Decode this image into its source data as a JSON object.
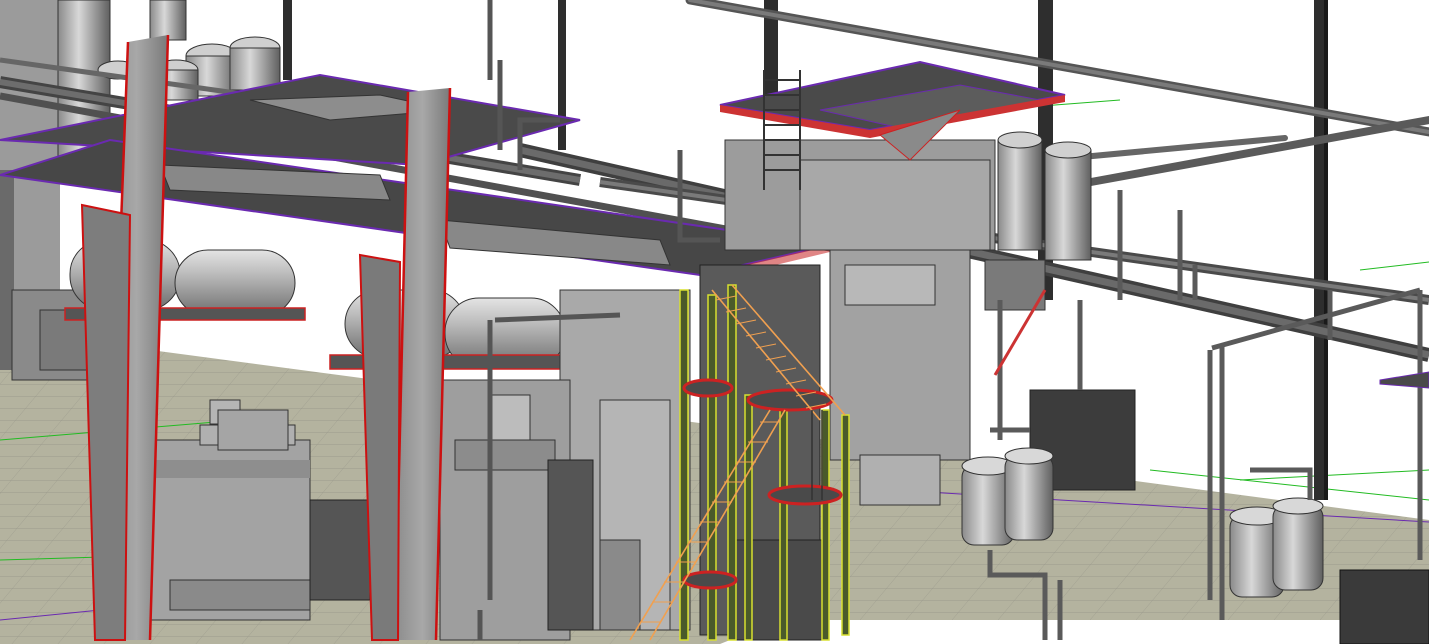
{
  "view": {
    "type": "3d-model-viewport",
    "style": "shaded-with-edges",
    "background": "#ffffff",
    "colors": {
      "floor": "#b4b39f",
      "floor_grid": "#8b8a7c",
      "floor_guides": "#22bb22",
      "steel": "#9a9a9a",
      "platform": "#4a4a4a",
      "column_edge": "#cc1111",
      "slab_edge": "#6a2ab0",
      "stair_highlight": "#f0a050",
      "frame_highlight": "#d8e030",
      "pipe": "#6e6e6e",
      "equipment_dark": "#3c3c3c"
    }
  },
  "model": {
    "tanks": [
      "horizontal-tank-left-a",
      "horizontal-tank-left-b",
      "horizontal-tank-mid",
      "vertical-vessel-right-a",
      "vertical-vessel-right-b",
      "vertical-vessel-far-right-a",
      "vertical-vessel-far-right-b"
    ],
    "structures": [
      "tapered-column-left",
      "tapered-column-mid",
      "upper-platform",
      "right-platform",
      "stair-tower",
      "pipe-rack"
    ]
  }
}
